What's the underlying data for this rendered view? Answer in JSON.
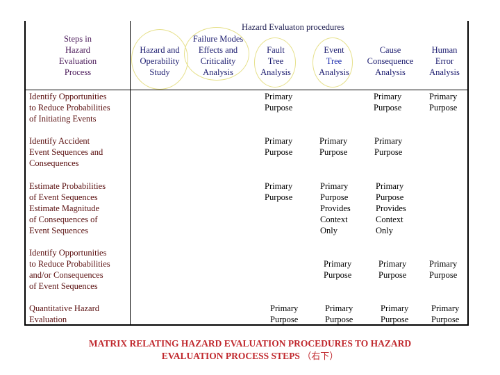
{
  "table": {
    "steps_header": [
      "Steps in",
      "Hazard",
      "Evaluation",
      "Process"
    ],
    "procedures_title": "Hazard Evaluaton procedures",
    "procedures": [
      {
        "id": "hazop",
        "lines": [
          "Hazard and",
          "Operability",
          "Study"
        ],
        "circled": true
      },
      {
        "id": "fmeca",
        "lines": [
          "Failure Modes",
          "Effects and",
          "Criticality",
          "Analysis"
        ],
        "circled": true
      },
      {
        "id": "fta",
        "lines": [
          "Fault",
          "Tree",
          "Analysis"
        ],
        "circled": true
      },
      {
        "id": "eta",
        "lines": [
          "Event",
          "Tree",
          "Analysis"
        ],
        "circled": true
      },
      {
        "id": "cca",
        "lines": [
          "Cause",
          "Consequence",
          "Analysis"
        ],
        "circled": false
      },
      {
        "id": "hea",
        "lines": [
          "Human",
          "Error",
          "Analysis"
        ],
        "circled": false
      }
    ],
    "rows": [
      {
        "step": [
          "Identify Opportunities",
          "to Reduce Probabilities",
          "of Initiating Events"
        ],
        "cells": {
          "fta": [
            "Primary",
            "Purpose"
          ],
          "cca": [
            "Primary",
            "Purpose"
          ],
          "hea": [
            "Primary",
            "Purpose"
          ]
        }
      },
      {
        "step": [
          "Identify Accident",
          "Event Sequences and",
          "Consequences"
        ],
        "cells": {
          "fta": [
            "Primary",
            "Purpose"
          ],
          "eta": [
            "Primary",
            "Purpose"
          ],
          "cca": [
            "Primary",
            "Purpose"
          ]
        }
      },
      {
        "step": [
          "Estimate Probabilities",
          "of Event Sequences",
          "Estimate Magnitude",
          "of Consequences of",
          "Event Sequences"
        ],
        "cells": {
          "fta": [
            "Primary",
            "Purpose"
          ],
          "eta": [
            "Primary",
            "Purpose",
            "Provides",
            "Context",
            "Only"
          ],
          "cca": [
            "Primary",
            "Purpose",
            "Provides",
            "Context",
            "Only"
          ]
        }
      },
      {
        "step": [
          "Identify Opportunities",
          "to Reduce Probabilities",
          "and/or Consequences",
          "of Event Sequences"
        ],
        "cells": {
          "eta": [
            "Primary",
            "Purpose"
          ],
          "cca": [
            "Primary",
            "Purpose"
          ],
          "hea": [
            "Primary",
            "Purpose"
          ]
        }
      },
      {
        "step": [
          "Quantitative Hazard",
          "Evaluation"
        ],
        "cells": {
          "fta": [
            "Primary",
            "Purpose"
          ],
          "eta": [
            "Primary",
            "Purpose"
          ],
          "cca": [
            "Primary",
            "Purpose"
          ],
          "hea": [
            "Primary",
            "Purpose"
          ]
        }
      }
    ]
  },
  "caption": {
    "line1": "MATRIX RELATING HAZARD EVALUATION PROCEDURES TO HAZARD",
    "line2": "EVALUATION PROCESS STEPS",
    "note": "（右下）"
  },
  "colors": {
    "caption": "#c0282d",
    "steps_header": "#4b1a5a",
    "procedures": "#1a1a6e",
    "step_labels": "#5a0f0f",
    "circles": "#e6e08a"
  }
}
